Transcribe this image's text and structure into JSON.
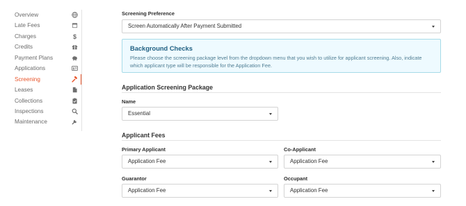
{
  "sidebar": {
    "items": [
      {
        "label": "Overview",
        "icon": "globe-icon"
      },
      {
        "label": "Late Fees",
        "icon": "calendar-icon"
      },
      {
        "label": "Charges",
        "icon": "dollar-icon"
      },
      {
        "label": "Credits",
        "icon": "gift-icon"
      },
      {
        "label": "Payment Plans",
        "icon": "piggy-bank-icon"
      },
      {
        "label": "Applications",
        "icon": "id-card-icon"
      },
      {
        "label": "Screening",
        "icon": "gavel-icon",
        "active": true
      },
      {
        "label": "Leases",
        "icon": "document-icon"
      },
      {
        "label": "Collections",
        "icon": "clipboard-check-icon"
      },
      {
        "label": "Inspections",
        "icon": "search-icon"
      },
      {
        "label": "Maintenance",
        "icon": "wrench-icon"
      }
    ],
    "active_color": "#e8542a"
  },
  "main": {
    "screening_preference": {
      "label": "Screening Preference",
      "value": "Screen Automatically After Payment Submitted"
    },
    "info_box": {
      "title": "Background Checks",
      "text": "Please choose the screening package level from the dropdown menu that you wish to utilize for applicant screening. Also, indicate which applicant type will be responsible for the Application Fee."
    },
    "package_section": {
      "title": "Application Screening Package",
      "name_label": "Name",
      "name_value": "Essential"
    },
    "fees_section": {
      "title": "Applicant Fees",
      "primary_applicant": {
        "label": "Primary Applicant",
        "value": "Application Fee"
      },
      "co_applicant": {
        "label": "Co-Applicant",
        "value": "Application Fee"
      },
      "guarantor": {
        "label": "Guarantor",
        "value": "Application Fee"
      },
      "occupant": {
        "label": "Occupant",
        "value": "Application Fee"
      }
    }
  }
}
